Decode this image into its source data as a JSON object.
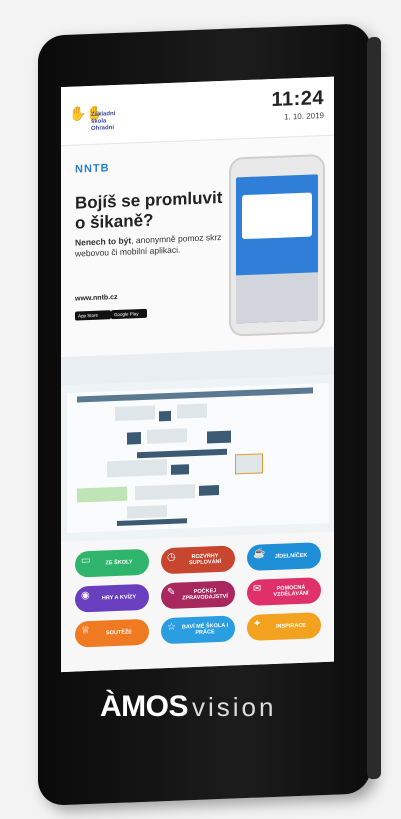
{
  "header": {
    "school_logo_text": "Základní škola Ohradní",
    "time": "11:24",
    "date": "1. 10. 2019"
  },
  "ad": {
    "brand": "NNTB",
    "headline": "Bojíš se promluvit o šikaně?",
    "text_bold": "Nenech to být",
    "text_rest": ", anonymně pomoz skrz webovou či mobilní aplikaci.",
    "url": "www.nntb.cz",
    "store_buttons": [
      "App Store",
      "Google Play"
    ]
  },
  "menu": {
    "buttons": [
      {
        "label": "ZE ŠKOLY",
        "icon": "book-icon",
        "color": "#2fb56b"
      },
      {
        "label": "ROZVRHY SUPLOVÁNÍ",
        "icon": "clock-icon",
        "color": "#c8452f"
      },
      {
        "label": "JÍDELNÍČEK",
        "icon": "food-icon",
        "color": "#1e8fd6"
      },
      {
        "label": "HRY A KVÍZY",
        "icon": "gamepad-icon",
        "color": "#6a3fbf"
      },
      {
        "label": "POČKEJ ZPRAVODAJSTVÍ",
        "icon": "pen-icon",
        "color": "#a8285e"
      },
      {
        "label": "POMOCNÁ VZDĚLÁVÁNÍ",
        "icon": "chat-icon",
        "color": "#e0306a"
      },
      {
        "label": "SOUTĚŽE",
        "icon": "trophy-icon",
        "color": "#f07a22"
      },
      {
        "label": "BAVÍ MĚ ŠKOLA I PRÁCE",
        "icon": "star-icon",
        "color": "#2a9ee0"
      },
      {
        "label": "INSPIRACE",
        "icon": "bulb-icon",
        "color": "#f2a21f"
      }
    ]
  },
  "footer": {
    "brand_bold": "ÀMOS",
    "brand_light": "vision"
  }
}
